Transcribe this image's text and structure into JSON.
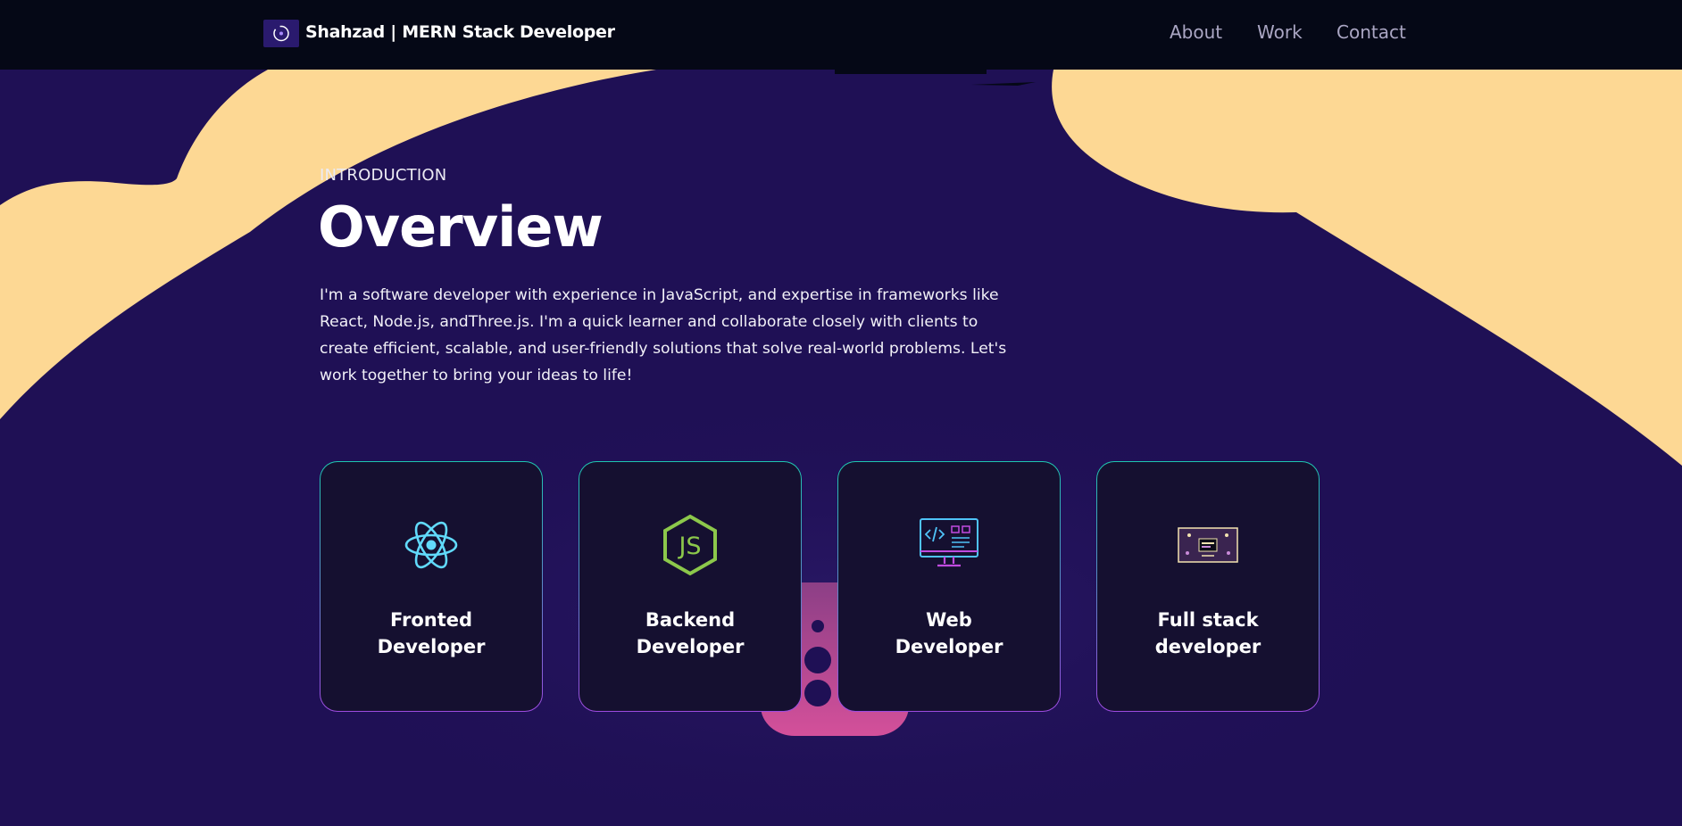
{
  "navbar": {
    "brand": "Shahzad  | MERN Stack Developer",
    "links": [
      "About",
      "Work",
      "Contact"
    ]
  },
  "hero": {
    "intro": "INTRODUCTION",
    "title": "Overview",
    "description": "I'm a software developer with experience in JavaScript, and expertise in frameworks like React, Node.js, andThree.js. I'm a quick learner and collaborate closely with clients to create efficient, scalable, and user-friendly solutions that solve real-world problems. Let's work together to bring your ideas to life!"
  },
  "services": [
    {
      "title": "Fronted Developer",
      "icon": "react-icon"
    },
    {
      "title": "Backend Developer",
      "icon": "nodejs-icon"
    },
    {
      "title": "Web Developer",
      "icon": "web-dev-icon"
    },
    {
      "title": "Full stack developer",
      "icon": "fullstack-icon"
    }
  ],
  "colors": {
    "background": "#1f1055",
    "navbar": "#050816",
    "blob": "#fdd894",
    "card": "#151030",
    "card_border_top": "#1ec7b0",
    "card_border_bottom": "#9d4be0",
    "nav_link": "#aaa6c3"
  }
}
